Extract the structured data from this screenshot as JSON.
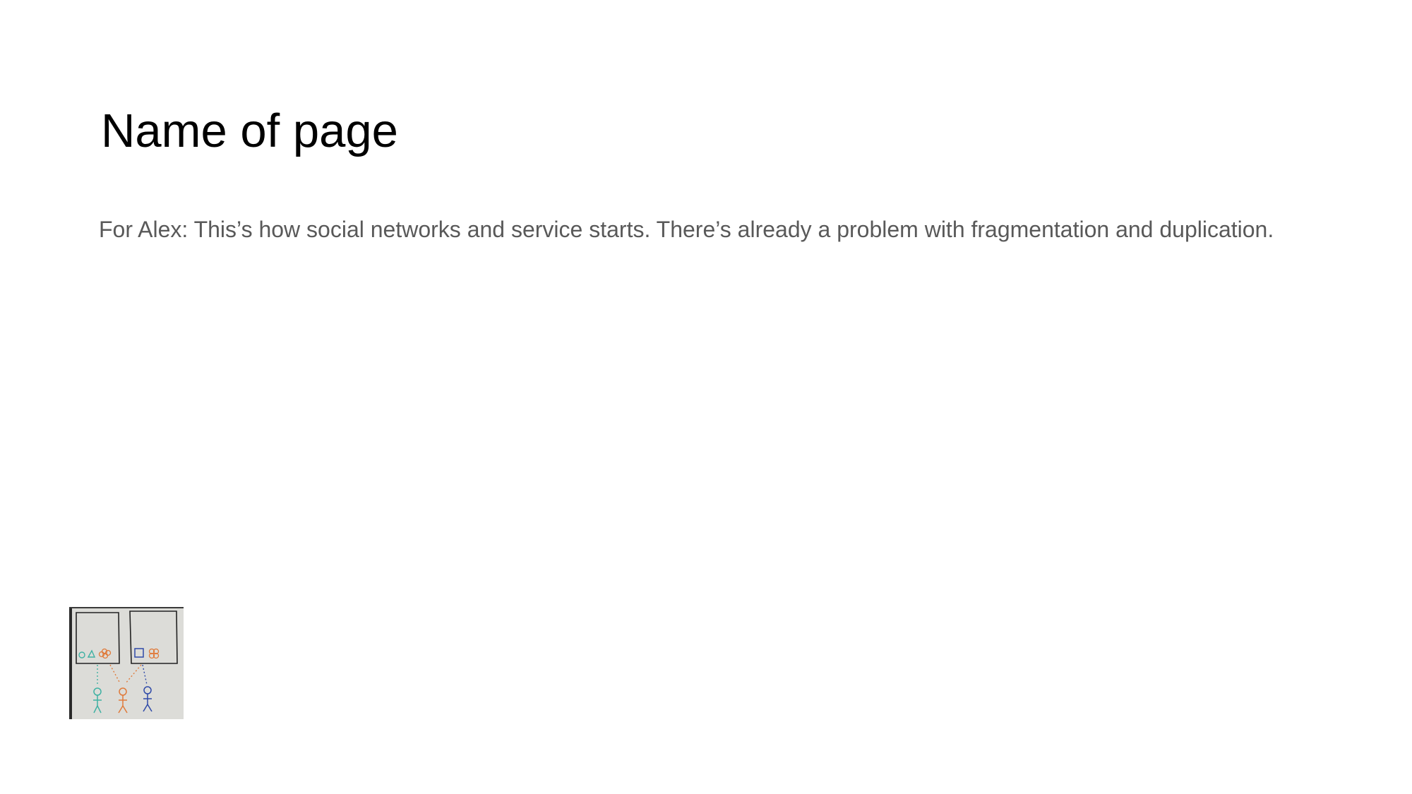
{
  "slide": {
    "title": "Name of page",
    "body": "For Alex: This’s how social networks and service starts. There’s already a problem with fragmentation and duplication."
  },
  "colors": {
    "title": "#000000",
    "body": "#595959",
    "background": "#ffffff",
    "teal": "#3fb1a3",
    "orange": "#e07a3a",
    "blue": "#2f4aa8"
  },
  "sketch": {
    "description_icon": "whiteboard-sketch-image"
  }
}
